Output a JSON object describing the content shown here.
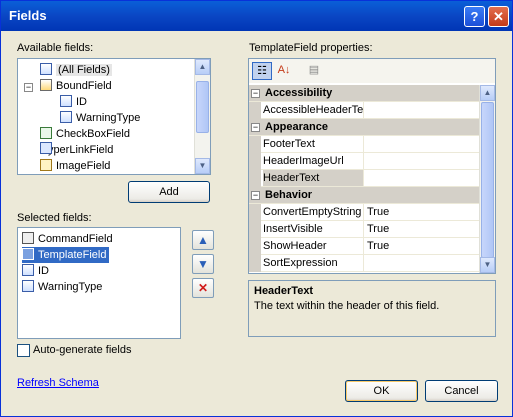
{
  "window": {
    "title": "Fields",
    "help_glyph": "?",
    "close_glyph": "✕"
  },
  "available": {
    "label": "Available fields:",
    "items": [
      {
        "label": "(All Fields)"
      },
      {
        "label": "BoundField"
      },
      {
        "label": "ID"
      },
      {
        "label": "WarningType"
      },
      {
        "label": "CheckBoxField"
      },
      {
        "label": "HyperLinkField"
      },
      {
        "label": "ImageField"
      }
    ],
    "add_button": "Add"
  },
  "selected": {
    "label": "Selected fields:",
    "items": [
      {
        "label": "CommandField"
      },
      {
        "label": "TemplateField"
      },
      {
        "label": "ID"
      },
      {
        "label": "WarningType"
      }
    ]
  },
  "move_up_glyph": "▲",
  "move_down_glyph": "▼",
  "delete_glyph": "✕",
  "properties": {
    "label": "TemplateField properties:",
    "rows": [
      {
        "type": "category",
        "name": "Accessibility"
      },
      {
        "type": "prop",
        "name": "AccessibleHeaderTe",
        "value": ""
      },
      {
        "type": "category",
        "name": "Appearance"
      },
      {
        "type": "prop",
        "name": "FooterText",
        "value": ""
      },
      {
        "type": "prop",
        "name": "HeaderImageUrl",
        "value": ""
      },
      {
        "type": "prop",
        "name": "HeaderText",
        "value": ""
      },
      {
        "type": "category",
        "name": "Behavior"
      },
      {
        "type": "prop",
        "name": "ConvertEmptyString",
        "value": "True"
      },
      {
        "type": "prop",
        "name": "InsertVisible",
        "value": "True"
      },
      {
        "type": "prop",
        "name": "ShowHeader",
        "value": "True"
      },
      {
        "type": "prop",
        "name": "SortExpression",
        "value": ""
      }
    ],
    "description_title": "HeaderText",
    "description_text": "The text within the header of this field."
  },
  "auto_generate": {
    "label": "Auto-generate fields",
    "checked": false
  },
  "refresh_schema": "Refresh Schema",
  "ok_button": "OK",
  "cancel_button": "Cancel",
  "colors": {
    "title_bar": "#0a46c4",
    "dialog_bg": "#ece9d8",
    "selection": "#316ac5",
    "close": "#c43a18"
  }
}
